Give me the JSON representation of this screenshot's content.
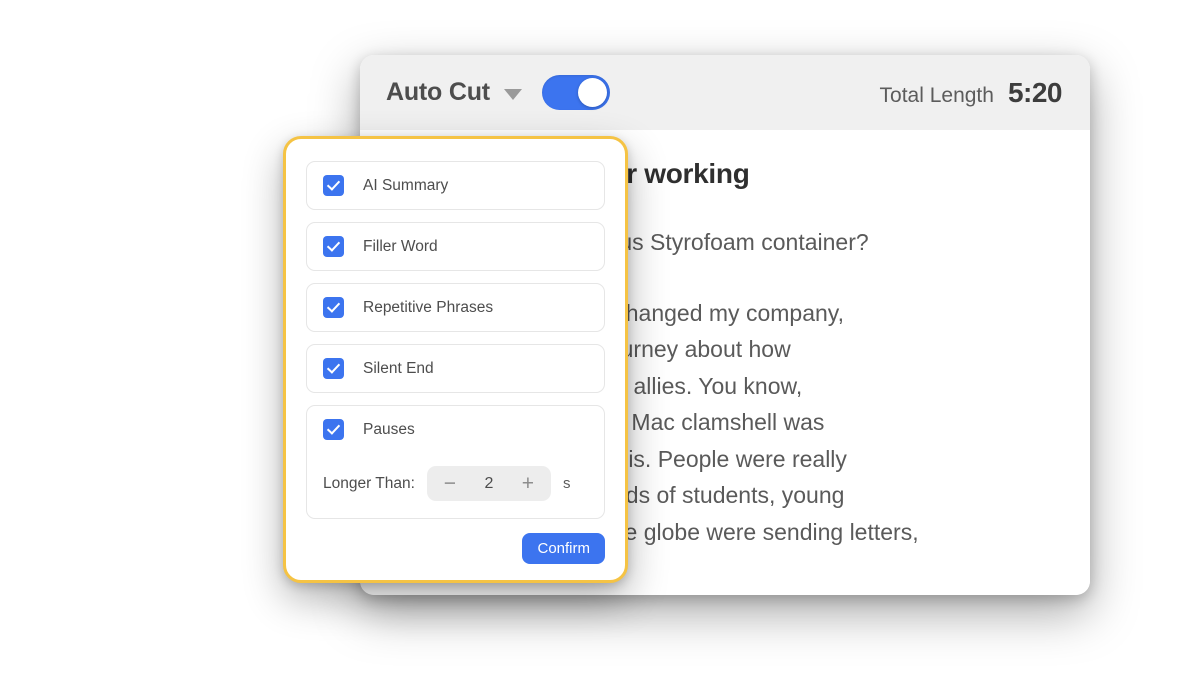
{
  "toolbar": {
    "menu_label": "Auto Cut",
    "caret_icon": "chevron-down-icon",
    "toggle_state": "on",
    "total_length_label": "Total Length",
    "total_length_value": "5:20"
  },
  "document": {
    "title": "…ness case for working",
    "paragraphs": [
      "…bers this infamous Styrofoam container?",
      "…changed me, it changed my company,\n…d a revelatory journey about how\n…can be your best allies. You know,\n…ate '80s, this Big Mac clamshell was\n…of a garbage crisis. People were really\n…xample, thousands of students, young\nstudents around the globe were sending letters,"
    ]
  },
  "autocut_panel": {
    "options": [
      {
        "label": "AI Summary",
        "checked": true
      },
      {
        "label": "Filler Word",
        "checked": true
      },
      {
        "label": "Repetitive Phrases",
        "checked": true
      },
      {
        "label": "Silent End",
        "checked": true
      },
      {
        "label": "Pauses",
        "checked": true
      }
    ],
    "pauses": {
      "threshold_label": "Longer Than:",
      "decrement_icon": "minus-icon",
      "decrement_label": "−",
      "value": "2",
      "increment_icon": "plus-icon",
      "increment_label": "+",
      "unit": "s"
    },
    "confirm_label": "Confirm",
    "border_color": "#f5c344",
    "accent_color": "#3c74ef"
  }
}
